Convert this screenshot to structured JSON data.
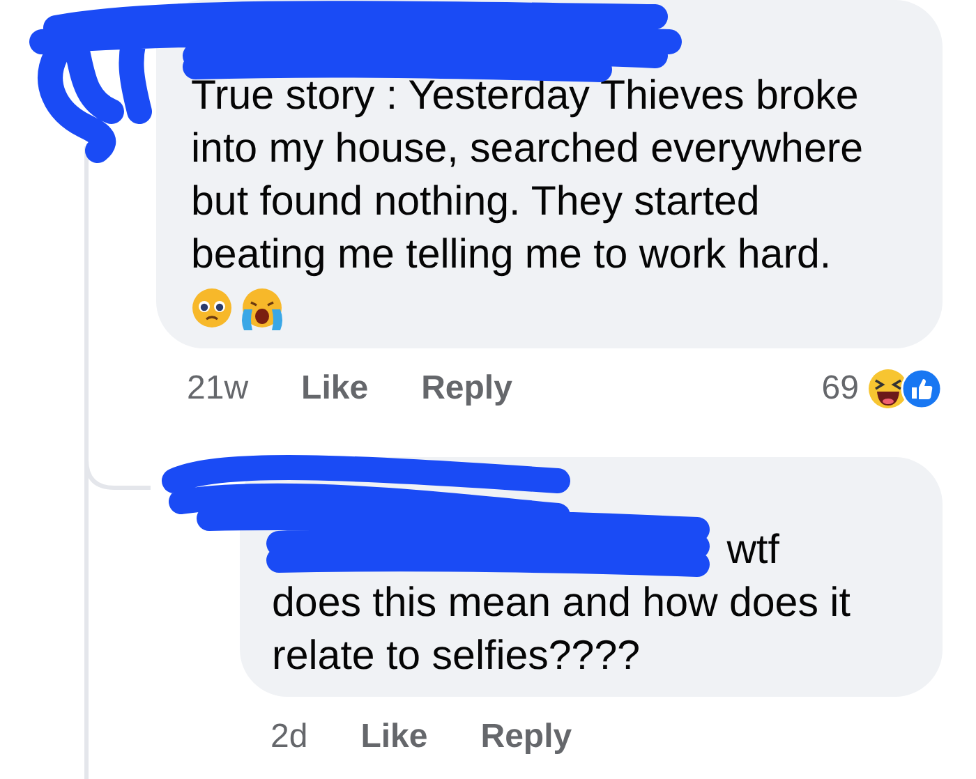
{
  "comments": [
    {
      "kind": "comment",
      "text": "True story : Yesterday Thieves broke into my house, searched everywhere but found nothing. They started beating me telling me to work hard.",
      "time": "21w",
      "actions": [
        "Like",
        "Reply"
      ],
      "reaction_count": "69"
    },
    {
      "kind": "reply",
      "text": "wtf does this mean and how does it relate to selfies????",
      "time": "2d",
      "actions": [
        "Like",
        "Reply"
      ]
    }
  ]
}
